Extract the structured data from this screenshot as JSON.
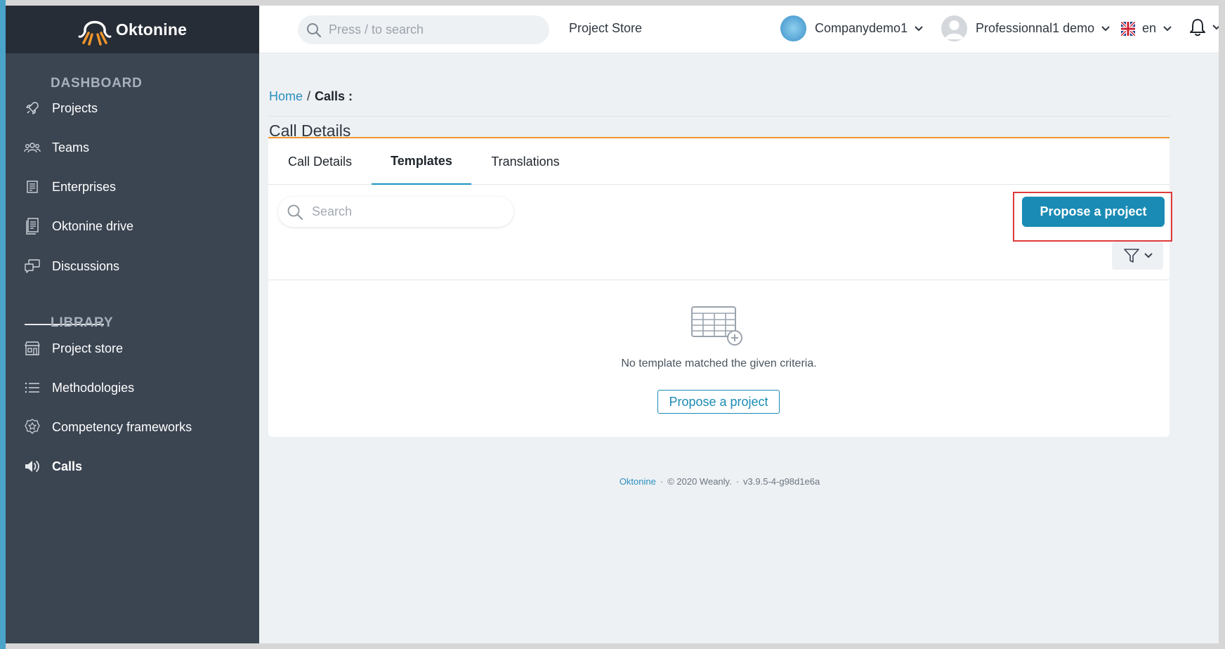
{
  "brand": {
    "name": "Oktonine"
  },
  "sidebar": {
    "sections": [
      {
        "title": "DASHBOARD"
      },
      {
        "title": "LIBRARY"
      }
    ],
    "items": [
      {
        "label": "Projects",
        "icon": "rocket-icon"
      },
      {
        "label": "Teams",
        "icon": "team-icon"
      },
      {
        "label": "Enterprises",
        "icon": "building-icon"
      },
      {
        "label": "Oktonine drive",
        "icon": "document-icon"
      },
      {
        "label": "Discussions",
        "icon": "chat-icon"
      },
      {
        "label": "Project store",
        "icon": "store-icon"
      },
      {
        "label": "Methodologies",
        "icon": "list-icon"
      },
      {
        "label": "Competency frameworks",
        "icon": "badge-icon"
      },
      {
        "label": "Calls",
        "icon": "megaphone-icon"
      }
    ]
  },
  "topbar": {
    "search_placeholder": "Press / to search",
    "project_store": "Project Store",
    "company": "Companydemo1",
    "user": "Professionnal1 demo",
    "language": "en"
  },
  "breadcrumb": {
    "home": "Home",
    "separator": "/",
    "current": "Calls :"
  },
  "page": {
    "title": "Call Details"
  },
  "tabs": [
    {
      "label": "Call Details",
      "active": false
    },
    {
      "label": "Templates",
      "active": true
    },
    {
      "label": "Translations",
      "active": false
    }
  ],
  "templates": {
    "search_placeholder": "Search",
    "propose_button": "Propose a project",
    "empty_message": "No template matched the given criteria.",
    "empty_action": "Propose a project"
  },
  "footer": {
    "brand": "Oktonine",
    "copyright": "© 2020 Weanly.",
    "version": "v3.9.5-4-g98d1e6a"
  },
  "colors": {
    "accent": "#1a8bb4",
    "sidebar": "#3b4451",
    "brand_bar": "#272d36",
    "tab_rule": "#f0962b",
    "highlight": "#e03a3a"
  }
}
